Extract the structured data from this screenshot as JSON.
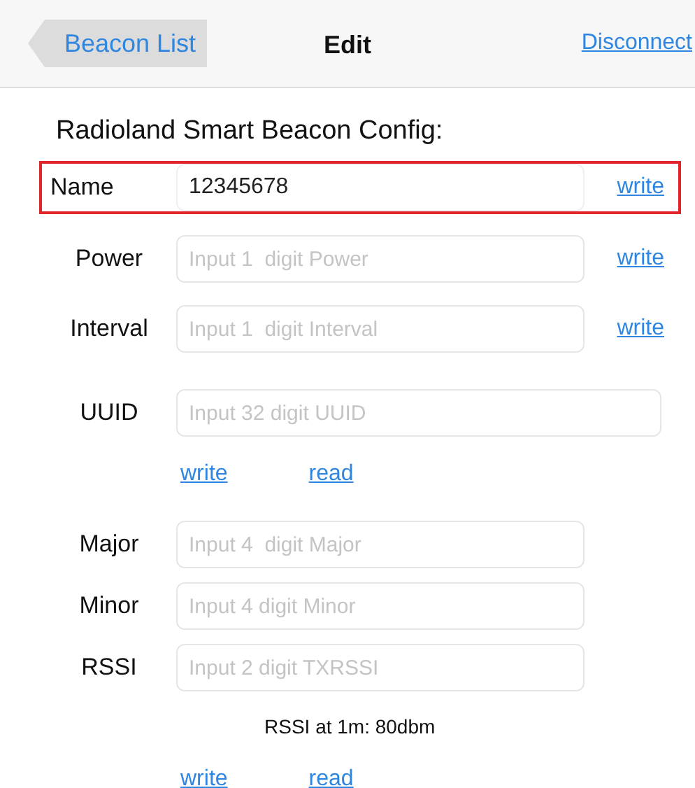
{
  "nav": {
    "back": "Beacon List",
    "title": "Edit",
    "action": "Disconnect"
  },
  "heading": "Radioland Smart Beacon Config:",
  "rows": [
    {
      "kind": "field",
      "label": "Name",
      "value": "12345678",
      "action": "write",
      "highlighted": true
    },
    {
      "kind": "field",
      "label": "Power",
      "placeholder": "Input 1  digit Power",
      "action": "write",
      "highlighted": false
    },
    {
      "kind": "field",
      "label": "Interval",
      "placeholder": "Input 1  digit Interval",
      "action": "write",
      "highlighted": false
    },
    {
      "kind": "wide-field",
      "label": "UUID",
      "placeholder": "Input 32 digit UUID"
    },
    {
      "kind": "actions",
      "links": [
        "write",
        "read"
      ]
    },
    {
      "kind": "field",
      "label": "Major",
      "placeholder": "Input 4  digit Major",
      "highlighted": false
    },
    {
      "kind": "field",
      "label": "Minor",
      "placeholder": "Input 4 digit Minor",
      "highlighted": false
    },
    {
      "kind": "field",
      "label": "RSSI",
      "placeholder": "Input 2 digit TXRSSI",
      "highlighted": false
    },
    {
      "kind": "note",
      "text": "RSSI at 1m: 80dbm"
    },
    {
      "kind": "actions",
      "links": [
        "write",
        "read"
      ]
    }
  ]
}
